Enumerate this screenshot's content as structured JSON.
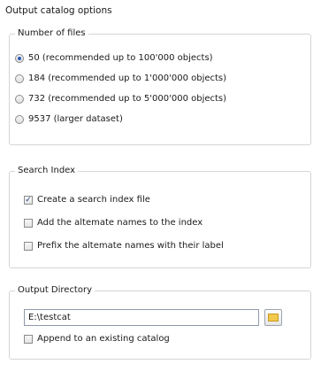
{
  "title": "Output catalog options",
  "number_of_files": {
    "legend": "Number of files",
    "options": [
      {
        "label": "50  (recommended up to 100'000 objects)",
        "selected": true
      },
      {
        "label": "184 (recommended up to 1'000'000 objects)",
        "selected": false
      },
      {
        "label": "732 (recommended up to 5'000'000 objects)",
        "selected": false
      },
      {
        "label": "9537 (larger dataset)",
        "selected": false
      }
    ]
  },
  "search_index": {
    "legend": "Search Index",
    "create_index": {
      "label": "Create a search index file",
      "checked": true
    },
    "add_alternate": {
      "label": "Add the altemate names to the index",
      "checked": false
    },
    "prefix_alternate": {
      "label": "Prefix the altemate names with their label",
      "checked": false
    }
  },
  "output_directory": {
    "legend": "Output Directory",
    "path_value": "E:\\testcat",
    "append": {
      "label": "Append to an existing catalog",
      "checked": false
    }
  }
}
